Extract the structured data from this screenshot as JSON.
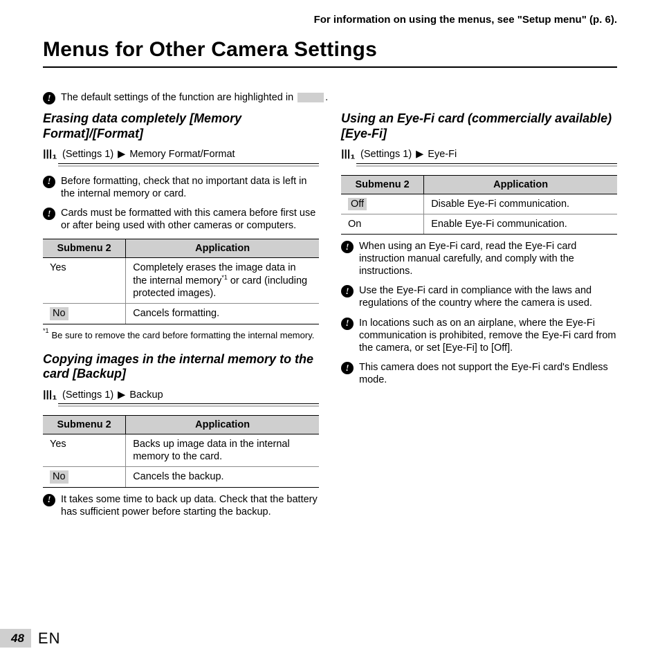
{
  "running_head": "For information on using the menus, see \"Setup menu\" (p. 6).",
  "main_title": "Menus for Other Camera Settings",
  "default_note_pre": "The default settings of the function are highlighted in ",
  "default_note_post": ".",
  "left": {
    "sec1": {
      "title": "Erasing data completely [Memory Format]/[Format]",
      "path_label": "(Settings 1)",
      "path_item": "Memory Format/Format",
      "notes": [
        "Before formatting, check that no important data is left in the internal memory or card.",
        "Cards must be formatted with this camera before first use or after being used with other cameras or computers."
      ],
      "table": {
        "h1": "Submenu 2",
        "h2": "Application",
        "rows": [
          {
            "c1": "Yes",
            "c2_pre": "Completely erases the image data in the internal memory",
            "c2_sup": "*1",
            "c2_post": " or card (including protected images).",
            "default": false
          },
          {
            "c1": "No",
            "c2": "Cancels formatting.",
            "default": true
          }
        ]
      },
      "footnote_mark": "*1",
      "footnote": "Be sure to remove the card before formatting the internal memory."
    },
    "sec2": {
      "title": "Copying images in the internal memory to the card [Backup]",
      "path_label": "(Settings 1)",
      "path_item": "Backup",
      "table": {
        "h1": "Submenu 2",
        "h2": "Application",
        "rows": [
          {
            "c1": "Yes",
            "c2": "Backs up image data in the internal memory to the card.",
            "default": false
          },
          {
            "c1": "No",
            "c2": "Cancels the backup.",
            "default": true
          }
        ]
      },
      "notes_after": [
        "It takes some time to back up data. Check that the battery has sufficient power before starting the backup."
      ]
    }
  },
  "right": {
    "sec1": {
      "title": "Using an Eye-Fi card (commercially available) [Eye-Fi]",
      "path_label": "(Settings 1)",
      "path_item": "Eye-Fi",
      "table": {
        "h1": "Submenu 2",
        "h2": "Application",
        "rows": [
          {
            "c1": "Off",
            "c2": "Disable Eye-Fi communication.",
            "default": true
          },
          {
            "c1": "On",
            "c2": "Enable Eye-Fi communication.",
            "default": false
          }
        ]
      },
      "notes_after": [
        "When using an Eye-Fi card, read the Eye-Fi card instruction manual carefully, and comply with the instructions.",
        "Use the Eye-Fi card in compliance with the laws and regulations of the country where the camera is used.",
        "In locations such as on an airplane, where the Eye-Fi communication is prohibited, remove the Eye-Fi card from the camera, or set [Eye-Fi] to [Off].",
        "This camera does not support the Eye-Fi card's Endless mode."
      ]
    }
  },
  "page_number": "48",
  "lang": "EN"
}
